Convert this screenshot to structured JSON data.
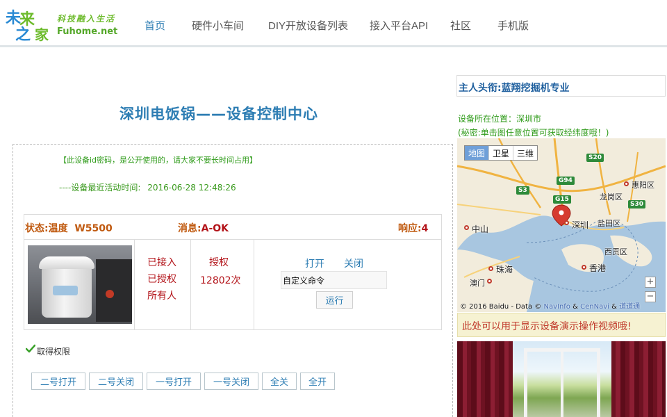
{
  "header": {
    "logo": {
      "mark_chars": [
        "未",
        "来",
        "之",
        "家"
      ],
      "slogan": "科技融入生活",
      "domain": "Fuhome.net"
    },
    "nav": [
      {
        "label": "首页",
        "active": true
      },
      {
        "label": "硬件小车间",
        "active": false
      },
      {
        "label": "DIY开放设备列表",
        "active": false
      },
      {
        "label": "接入平台API",
        "active": false
      },
      {
        "label": "社区",
        "active": false
      },
      {
        "label": "手机版",
        "active": false
      }
    ]
  },
  "main": {
    "title": "深圳电饭锅——设备控制中心",
    "notice": "【此设备id密码，是公开使用的，请大家不要长时间占用】",
    "last_active_label": "----设备最近活动时间:",
    "last_active_value": "2016-06-28 12:48:26",
    "status": {
      "state_label": "状态:",
      "state_value": "温度  W5500",
      "message_label": "消息:",
      "message_value": "A-OK",
      "response_label": "响应:",
      "response_value": "4"
    },
    "access": [
      "已接入",
      "已授权",
      "所有人"
    ],
    "auth": {
      "label": "授权",
      "count": "12802次"
    },
    "controls": {
      "open": "打开",
      "close": "关闭",
      "custom_placeholder": "自定义命令",
      "custom_value": "自定义命令",
      "run": "运行"
    },
    "permission_text": "取得权限",
    "buttons": [
      "二号打开",
      "二号关闭",
      "一号打开",
      "一号关闭",
      "全关",
      "全开"
    ]
  },
  "sidebar": {
    "owner": "主人头衔:蓝翔挖掘机专业",
    "location": "设备所在位置：深圳市",
    "location_hint": "(秘密:单击图任意位置可获取经纬度哦！)",
    "map": {
      "types": [
        "地图",
        "卫星",
        "三维"
      ],
      "active_type": "地图",
      "labels": [
        "惠阳区",
        "龙岗区",
        "中山",
        "深圳",
        "盐田区",
        "西贡区",
        "珠海",
        "香港",
        "澳门"
      ],
      "roads": [
        "S20",
        "G94",
        "S3",
        "G15",
        "S30"
      ],
      "zoom_in": "+",
      "zoom_out": "−",
      "copyright_prefix": "© 2016 Baidu - Data ©",
      "copyright_link1": "NavInfo",
      "copyright_amp1": "&",
      "copyright_link2": "CenNavi",
      "copyright_amp2": "&",
      "copyright_link3": "道道通"
    },
    "video_hint": "此处可以用于显示设备演示操作视频哦!"
  },
  "colors": {
    "accent_blue": "#2d7db3",
    "status_red": "#b3141a",
    "status_orange": "#c05a10",
    "green": "#2f9b1a"
  }
}
